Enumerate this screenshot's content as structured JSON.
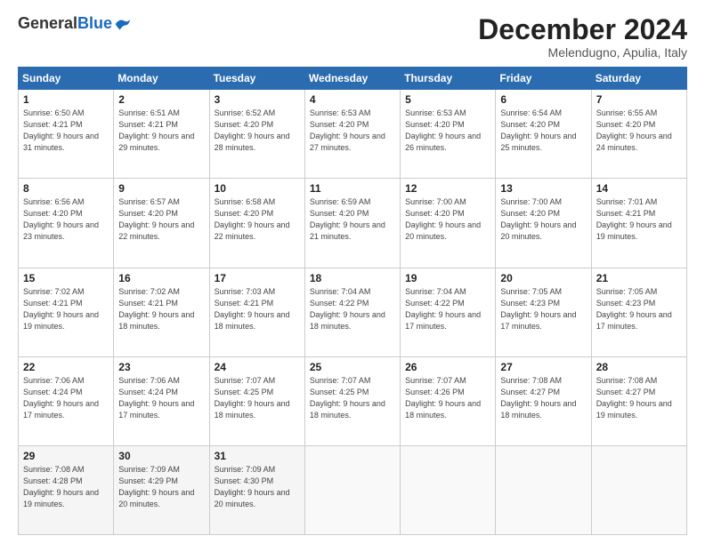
{
  "logo": {
    "general": "General",
    "blue": "Blue"
  },
  "header": {
    "month": "December 2024",
    "location": "Melendugno, Apulia, Italy"
  },
  "weekdays": [
    "Sunday",
    "Monday",
    "Tuesday",
    "Wednesday",
    "Thursday",
    "Friday",
    "Saturday"
  ],
  "weeks": [
    [
      {
        "day": "1",
        "sunrise": "6:50 AM",
        "sunset": "4:21 PM",
        "daylight": "9 hours and 31 minutes."
      },
      {
        "day": "2",
        "sunrise": "6:51 AM",
        "sunset": "4:21 PM",
        "daylight": "9 hours and 29 minutes."
      },
      {
        "day": "3",
        "sunrise": "6:52 AM",
        "sunset": "4:20 PM",
        "daylight": "9 hours and 28 minutes."
      },
      {
        "day": "4",
        "sunrise": "6:53 AM",
        "sunset": "4:20 PM",
        "daylight": "9 hours and 27 minutes."
      },
      {
        "day": "5",
        "sunrise": "6:53 AM",
        "sunset": "4:20 PM",
        "daylight": "9 hours and 26 minutes."
      },
      {
        "day": "6",
        "sunrise": "6:54 AM",
        "sunset": "4:20 PM",
        "daylight": "9 hours and 25 minutes."
      },
      {
        "day": "7",
        "sunrise": "6:55 AM",
        "sunset": "4:20 PM",
        "daylight": "9 hours and 24 minutes."
      }
    ],
    [
      {
        "day": "8",
        "sunrise": "6:56 AM",
        "sunset": "4:20 PM",
        "daylight": "9 hours and 23 minutes."
      },
      {
        "day": "9",
        "sunrise": "6:57 AM",
        "sunset": "4:20 PM",
        "daylight": "9 hours and 22 minutes."
      },
      {
        "day": "10",
        "sunrise": "6:58 AM",
        "sunset": "4:20 PM",
        "daylight": "9 hours and 22 minutes."
      },
      {
        "day": "11",
        "sunrise": "6:59 AM",
        "sunset": "4:20 PM",
        "daylight": "9 hours and 21 minutes."
      },
      {
        "day": "12",
        "sunrise": "7:00 AM",
        "sunset": "4:20 PM",
        "daylight": "9 hours and 20 minutes."
      },
      {
        "day": "13",
        "sunrise": "7:00 AM",
        "sunset": "4:20 PM",
        "daylight": "9 hours and 20 minutes."
      },
      {
        "day": "14",
        "sunrise": "7:01 AM",
        "sunset": "4:21 PM",
        "daylight": "9 hours and 19 minutes."
      }
    ],
    [
      {
        "day": "15",
        "sunrise": "7:02 AM",
        "sunset": "4:21 PM",
        "daylight": "9 hours and 19 minutes."
      },
      {
        "day": "16",
        "sunrise": "7:02 AM",
        "sunset": "4:21 PM",
        "daylight": "9 hours and 18 minutes."
      },
      {
        "day": "17",
        "sunrise": "7:03 AM",
        "sunset": "4:21 PM",
        "daylight": "9 hours and 18 minutes."
      },
      {
        "day": "18",
        "sunrise": "7:04 AM",
        "sunset": "4:22 PM",
        "daylight": "9 hours and 18 minutes."
      },
      {
        "day": "19",
        "sunrise": "7:04 AM",
        "sunset": "4:22 PM",
        "daylight": "9 hours and 17 minutes."
      },
      {
        "day": "20",
        "sunrise": "7:05 AM",
        "sunset": "4:23 PM",
        "daylight": "9 hours and 17 minutes."
      },
      {
        "day": "21",
        "sunrise": "7:05 AM",
        "sunset": "4:23 PM",
        "daylight": "9 hours and 17 minutes."
      }
    ],
    [
      {
        "day": "22",
        "sunrise": "7:06 AM",
        "sunset": "4:24 PM",
        "daylight": "9 hours and 17 minutes."
      },
      {
        "day": "23",
        "sunrise": "7:06 AM",
        "sunset": "4:24 PM",
        "daylight": "9 hours and 17 minutes."
      },
      {
        "day": "24",
        "sunrise": "7:07 AM",
        "sunset": "4:25 PM",
        "daylight": "9 hours and 18 minutes."
      },
      {
        "day": "25",
        "sunrise": "7:07 AM",
        "sunset": "4:25 PM",
        "daylight": "9 hours and 18 minutes."
      },
      {
        "day": "26",
        "sunrise": "7:07 AM",
        "sunset": "4:26 PM",
        "daylight": "9 hours and 18 minutes."
      },
      {
        "day": "27",
        "sunrise": "7:08 AM",
        "sunset": "4:27 PM",
        "daylight": "9 hours and 18 minutes."
      },
      {
        "day": "28",
        "sunrise": "7:08 AM",
        "sunset": "4:27 PM",
        "daylight": "9 hours and 19 minutes."
      }
    ],
    [
      {
        "day": "29",
        "sunrise": "7:08 AM",
        "sunset": "4:28 PM",
        "daylight": "9 hours and 19 minutes."
      },
      {
        "day": "30",
        "sunrise": "7:09 AM",
        "sunset": "4:29 PM",
        "daylight": "9 hours and 20 minutes."
      },
      {
        "day": "31",
        "sunrise": "7:09 AM",
        "sunset": "4:30 PM",
        "daylight": "9 hours and 20 minutes."
      },
      null,
      null,
      null,
      null
    ]
  ]
}
